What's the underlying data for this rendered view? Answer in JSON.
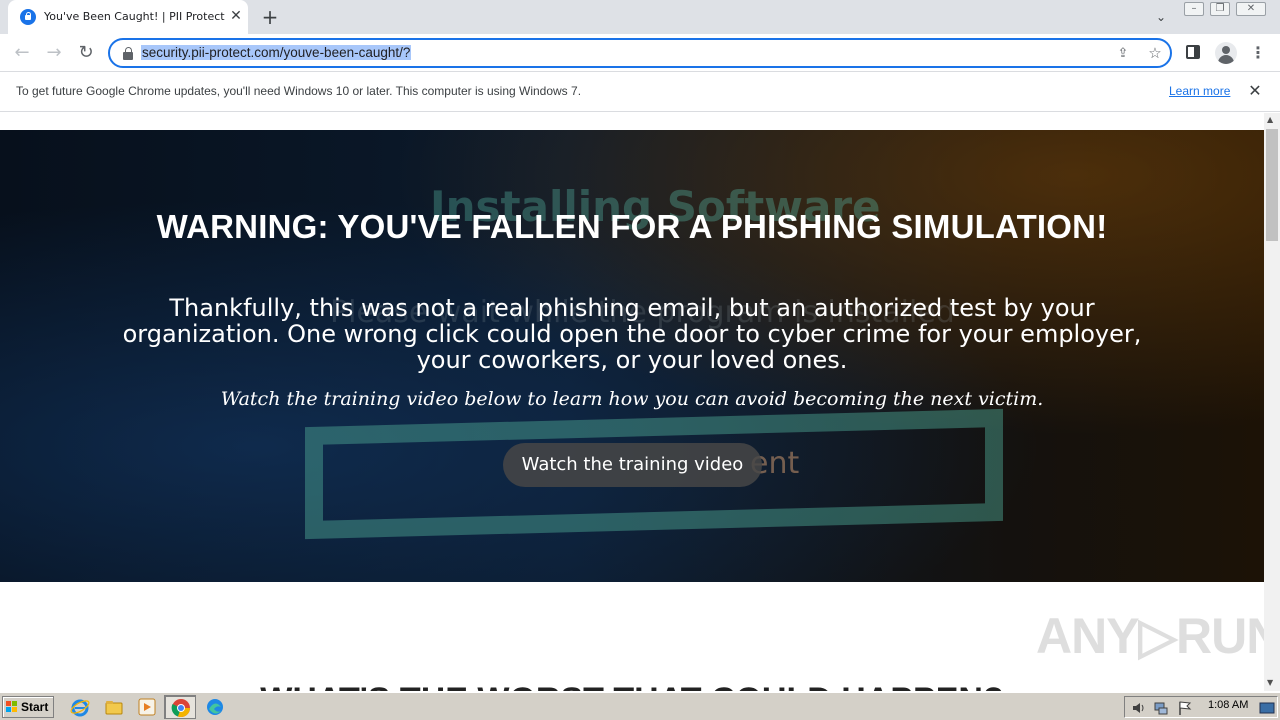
{
  "browser": {
    "tab": {
      "title": "You've Been Caught! | PII Protect",
      "close_glyph": "✕"
    },
    "new_tab_glyph": "+",
    "tab_search_glyph": "⌄",
    "window_controls": {
      "minimize": "–",
      "restore": "❐",
      "close": "✕"
    },
    "nav": {
      "back_glyph": "←",
      "forward_glyph": "→",
      "reload_glyph": "↻"
    },
    "url": "security.pii-protect.com/youve-been-caught/?",
    "share_glyph": "⇪",
    "bookmark_glyph": "☆",
    "menu_glyph": "⋮"
  },
  "infobar": {
    "message": "To get future Google Chrome updates, you'll need Windows 10 or later. This computer is using Windows 7.",
    "link": "Learn more",
    "close_glyph": "✕"
  },
  "hero": {
    "background_text_1": "Installing Software",
    "background_text_2": "Please wait while the program is installed",
    "background_frame_text": "ent",
    "title": "WARNING: YOU'VE FALLEN FOR A PHISHING SIMULATION!",
    "body": "Thankfully, this was not a real phishing email, but an authorized test by your organization. One wrong click could open the door to cyber crime for your employer, your coworkers, or your loved ones.",
    "subtitle": "Watch the training video below to learn how you can avoid becoming the next victim.",
    "button": "Watch the training video"
  },
  "next_section": {
    "heading": "WHAT'S THE WORST THAT COULD HAPPEN?"
  },
  "watermark": "ANY▷RUN",
  "scrollbar": {
    "up_glyph": "▲",
    "down_glyph": "▼"
  },
  "taskbar": {
    "start": "Start",
    "clock": "1:08 AM",
    "pinned": [
      "internet-explorer-icon",
      "file-explorer-icon",
      "media-player-icon",
      "chrome-icon",
      "edge-icon"
    ]
  },
  "colors": {
    "accent": "#1a73e8",
    "url_selection": "#a8c7fa",
    "hero_title": "#ffffff",
    "button_bg": "#464646"
  }
}
